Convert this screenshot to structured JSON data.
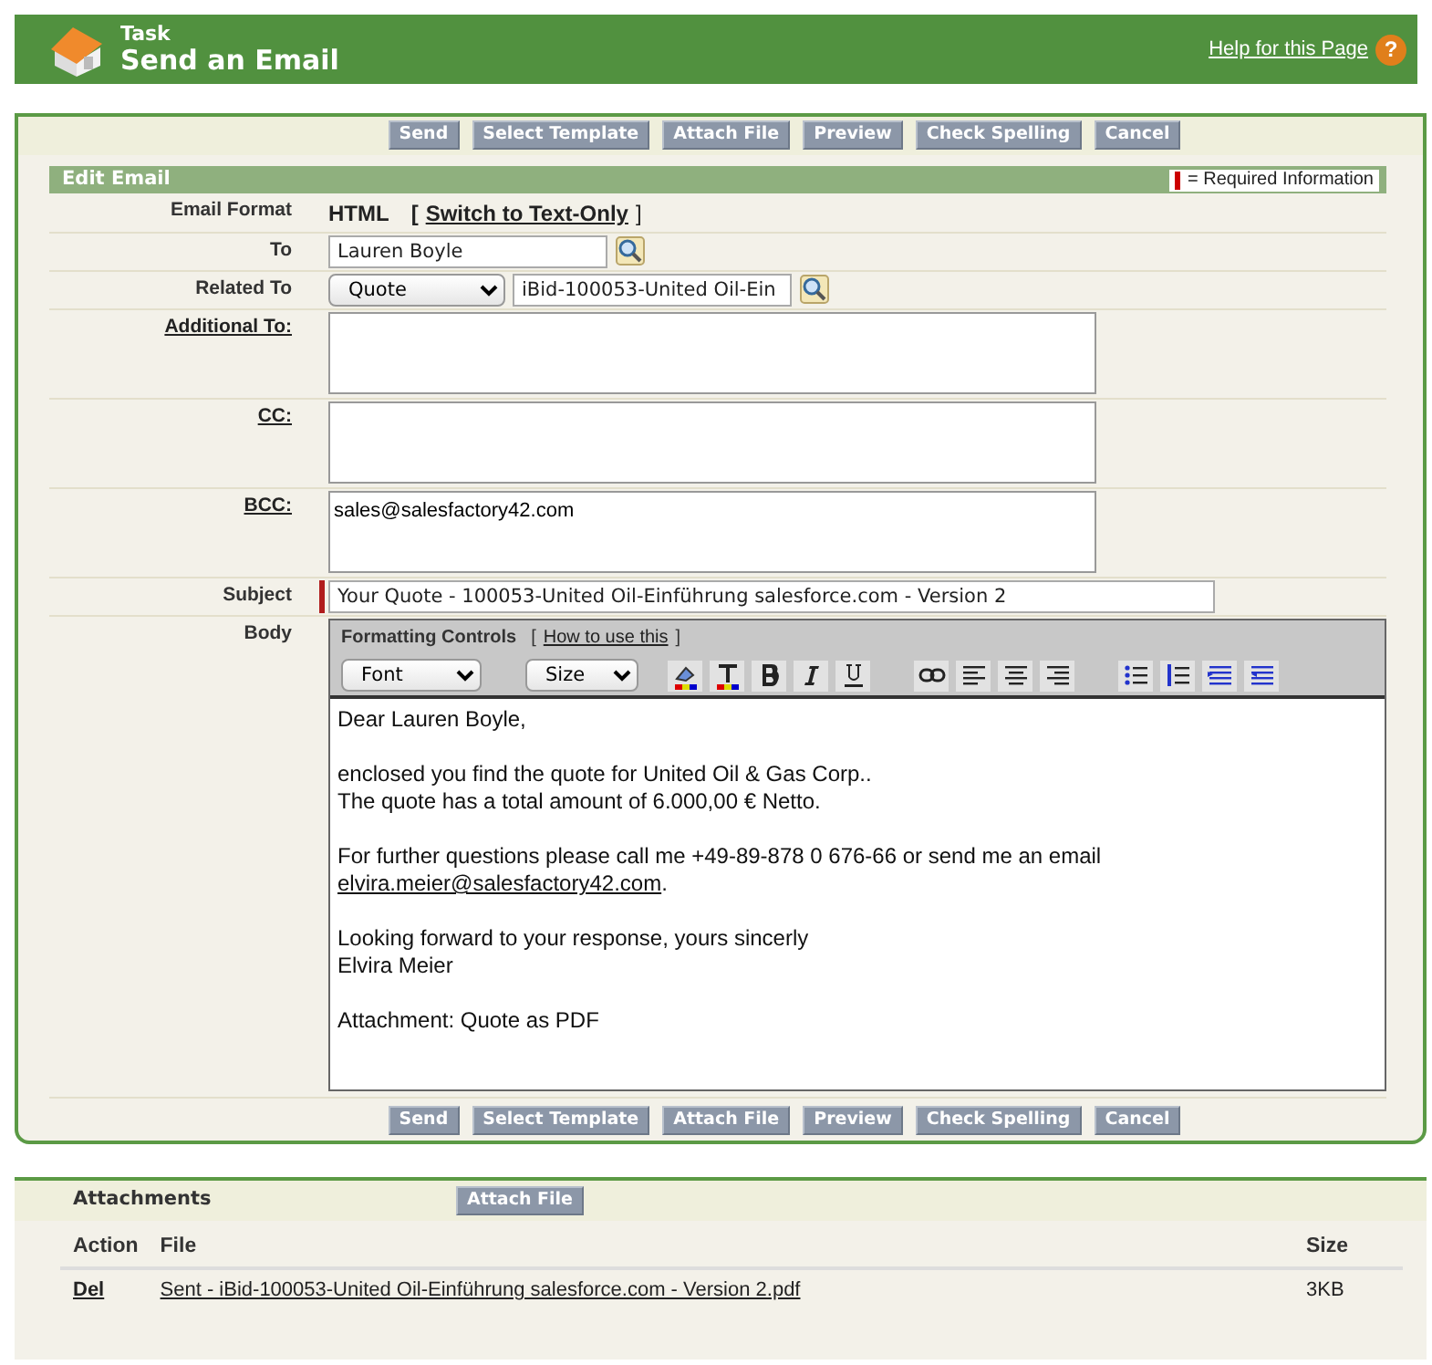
{
  "header": {
    "object": "Task",
    "title": "Send an Email",
    "help_link": "Help for this Page",
    "help_icon": "?"
  },
  "buttons_top": [
    "Send",
    "Select Template",
    "Attach File",
    "Preview",
    "Check Spelling",
    "Cancel"
  ],
  "section": {
    "title": "Edit Email",
    "legend": "= Required Information"
  },
  "fields": [
    {
      "kind": "format",
      "label": "Email Format",
      "label_link": false,
      "required": false,
      "value": "HTML",
      "bracket_open": "[",
      "link": "Switch to Text-Only",
      "bracket_close": "]"
    },
    {
      "kind": "lookup",
      "label": "To",
      "label_link": false,
      "required": false,
      "value": "Lauren Boyle"
    },
    {
      "kind": "related",
      "label": "Related To",
      "label_link": false,
      "required": false,
      "select": "Quote",
      "value": "iBid-100053-United Oil-Ein"
    },
    {
      "kind": "textarea",
      "label": "Additional To:",
      "label_link": true,
      "required": false
    },
    {
      "kind": "textarea",
      "label": "CC:",
      "label_link": true,
      "required": false
    },
    {
      "kind": "textarea",
      "label": "BCC:",
      "label_link": true,
      "required": false,
      "value": "sales@salesfactory42.com"
    },
    {
      "kind": "subject",
      "label": "Subject",
      "label_link": false,
      "required": true,
      "value": "Your Quote - 100053-United Oil-Einführung salesforce.com - Version 2"
    },
    {
      "kind": "editor",
      "label": "Body",
      "label_link": false,
      "required": false
    }
  ],
  "editor": {
    "toolbar_title": "Formatting Controls",
    "help_open": "[",
    "help_link": "How to use this",
    "help_close": "]",
    "font": "Font",
    "size": "Size",
    "paragraphs": [
      [
        {
          "text": "Dear Lauren Boyle,"
        }
      ],
      [
        {
          "text": "enclosed you find the quote for United Oil & Gas Corp.."
        },
        {
          "text": "The quote has a total amount of 6.000,00 € Netto."
        }
      ],
      [
        {
          "text": "For further questions please call me +49-89-878 0 676-66 or send me an email"
        },
        {
          "link": "elvira.meier@salesfactory42.com",
          "suffix": "."
        }
      ],
      [
        {
          "text": "Looking forward to your response, yours sincerly"
        },
        {
          "text": "Elvira Meier"
        }
      ],
      [
        {
          "text": "Attachment: Quote as PDF"
        }
      ]
    ]
  },
  "buttons_bottom": [
    "Send",
    "Select Template",
    "Attach File",
    "Preview",
    "Check Spelling",
    "Cancel"
  ],
  "attachments": {
    "title": "Attachments",
    "button": "Attach File",
    "columns": [
      "Action",
      "File",
      "Size"
    ],
    "rows": [
      {
        "action": "Del",
        "file": "Sent - iBid-100053-United Oil-Einführung salesforce.com - Version 2.pdf",
        "size": "3KB"
      }
    ]
  }
}
